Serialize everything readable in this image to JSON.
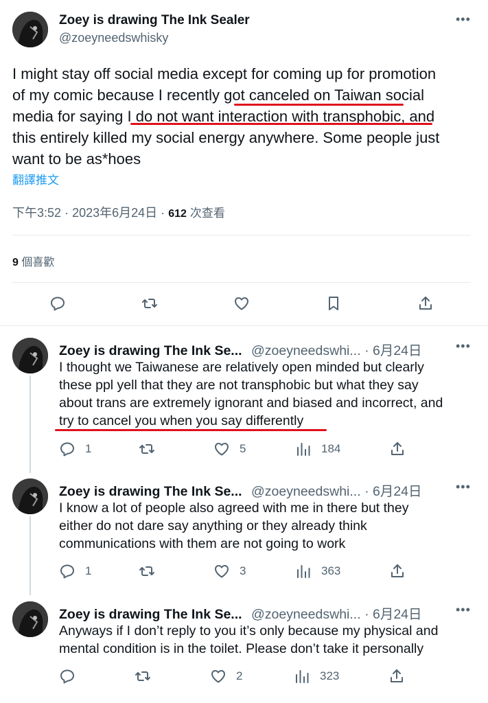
{
  "main_tweet": {
    "display_name": "Zoey is drawing The Ink Sealer",
    "handle": "@zoeyneedswhisky",
    "lines": [
      "I might stay off social media except for coming up for promotion",
      "of my comic because I recently got canceled on Taiwan social",
      "media for saying I do not want interaction with transphobic, and",
      "this entirely killed my social energy anywhere. Some people just",
      "want to be as*hoes"
    ],
    "translate_label": "翻譯推文",
    "time": "下午3:52",
    "date": "2023年6月24日",
    "views_count": "612",
    "views_label": "次查看",
    "likes_count": "9",
    "likes_label": "個喜歡",
    "more_icon": "more-icon",
    "actions": [
      "reply-icon",
      "retweet-icon",
      "like-icon",
      "bookmark-icon",
      "share-icon"
    ]
  },
  "replies": [
    {
      "display_name": "Zoey is drawing The Ink Se...",
      "handle": "@zoeyneedswhi...",
      "date": "6月24日",
      "lines": [
        "I thought we Taiwanese are relatively open minded but clearly",
        "these ppl yell that they are not transphobic but what they say",
        "about trans are extremely ignorant and biased and incorrect, and",
        "try to cancel you when you say differently"
      ],
      "reply_count": "1",
      "retweet_count": "",
      "like_count": "5",
      "view_count": "184"
    },
    {
      "display_name": "Zoey is drawing The Ink Se...",
      "handle": "@zoeyneedswhi...",
      "date": "6月24日",
      "lines": [
        "I know a lot of people also agreed with me in there but they",
        "either do not dare say anything or they already think",
        "communications with them are not going to work"
      ],
      "reply_count": "1",
      "retweet_count": "",
      "like_count": "3",
      "view_count": "363"
    },
    {
      "display_name": "Zoey is drawing The Ink Se...",
      "handle": "@zoeyneedswhi...",
      "date": "6月24日",
      "lines": [
        "Anyways if I don’t reply to you it’s only because my physical and",
        "mental condition is in the toilet. Please don’t take it personally"
      ],
      "reply_count": "",
      "retweet_count": "",
      "like_count": "2",
      "view_count": "323"
    }
  ],
  "separator_dot": "·",
  "colors": {
    "accent": "#1d9bf0",
    "annotation": "#e0101c",
    "muted": "#536471",
    "text": "#0f1419"
  }
}
